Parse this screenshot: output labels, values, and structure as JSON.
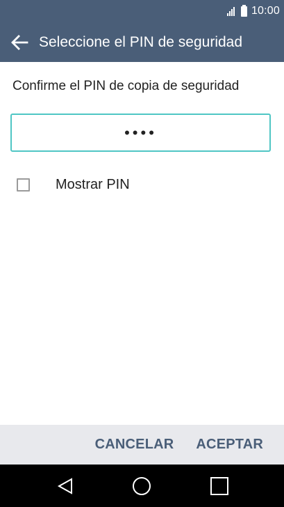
{
  "status_bar": {
    "time": "10:00",
    "icons": [
      "signal-icon",
      "battery-icon"
    ]
  },
  "app_bar": {
    "back_icon": "arrow-left-icon",
    "title": "Seleccione el PIN de seguridad"
  },
  "main": {
    "heading": "Confirme el PIN de copia de seguridad",
    "pin_field_value": "••••",
    "show_pin_label": "Mostrar PIN",
    "show_pin_checked": false
  },
  "buttons": {
    "cancel": "CANCELAR",
    "accept": "ACEPTAR"
  },
  "nav_bar": {
    "back": "triangle-back-icon",
    "home": "circle-home-icon",
    "recents": "square-recents-icon"
  },
  "colors": {
    "header": "#4a5e78",
    "field_border": "#4fc6c4",
    "button_bar": "#e8e9ed",
    "button_text": "#4a5e78"
  }
}
